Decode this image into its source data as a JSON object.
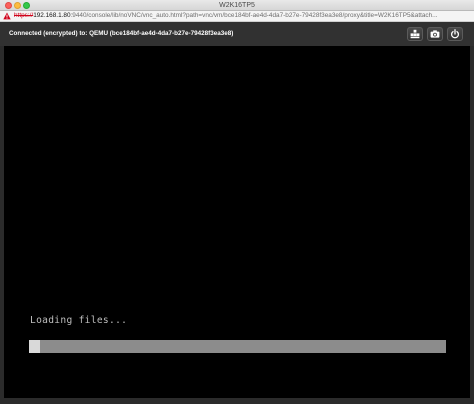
{
  "window": {
    "title": "W2K16TP5"
  },
  "address_bar": {
    "scheme": "https://",
    "host": "192.168.1.80",
    "rest": ":9440/console/lib/noVNC/vnc_auto.html?path=vnc/vm/bce184bf-ae4d-4da7-b27e-79428f3ea3e8/proxy&title=W2K16TP5&attach..."
  },
  "vnc_bar": {
    "status": "Connected (encrypted) to: QEMU (bce184bf-ae4d-4da7-b27e-79428f3ea3e8)",
    "buttons": [
      {
        "name": "send-keys-button",
        "icon": "keyboard-icon"
      },
      {
        "name": "screenshot-button",
        "icon": "camera-icon"
      },
      {
        "name": "power-button",
        "icon": "power-icon"
      }
    ]
  },
  "screen": {
    "loading_text": "Loading files...",
    "progress_fraction": 0.027
  },
  "colors": {
    "vnc_bar_bg": "#313131",
    "screen_bg": "#000000",
    "progress_track": "#8c8c8c",
    "progress_fill": "#d9d9d9",
    "insecure_scheme": "#d0021b"
  }
}
